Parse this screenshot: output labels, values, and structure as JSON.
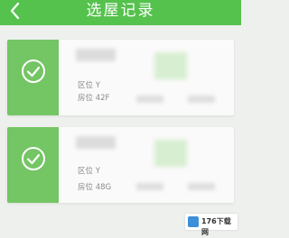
{
  "header": {
    "title": "选屋记录",
    "back_icon": "chevron-left-icon"
  },
  "records": [
    {
      "status_icon": "check-circle-icon",
      "status_color": "#74c564",
      "location": "区位 Y",
      "unit": "房位 42F"
    },
    {
      "status_icon": "check-circle-icon",
      "status_color": "#74c564",
      "location": "区位 Y",
      "unit": "房位 48G"
    }
  ],
  "watermark": {
    "text": "176下载网"
  },
  "colors": {
    "brand_green": "#55c24d",
    "background": "#eef0ee"
  }
}
